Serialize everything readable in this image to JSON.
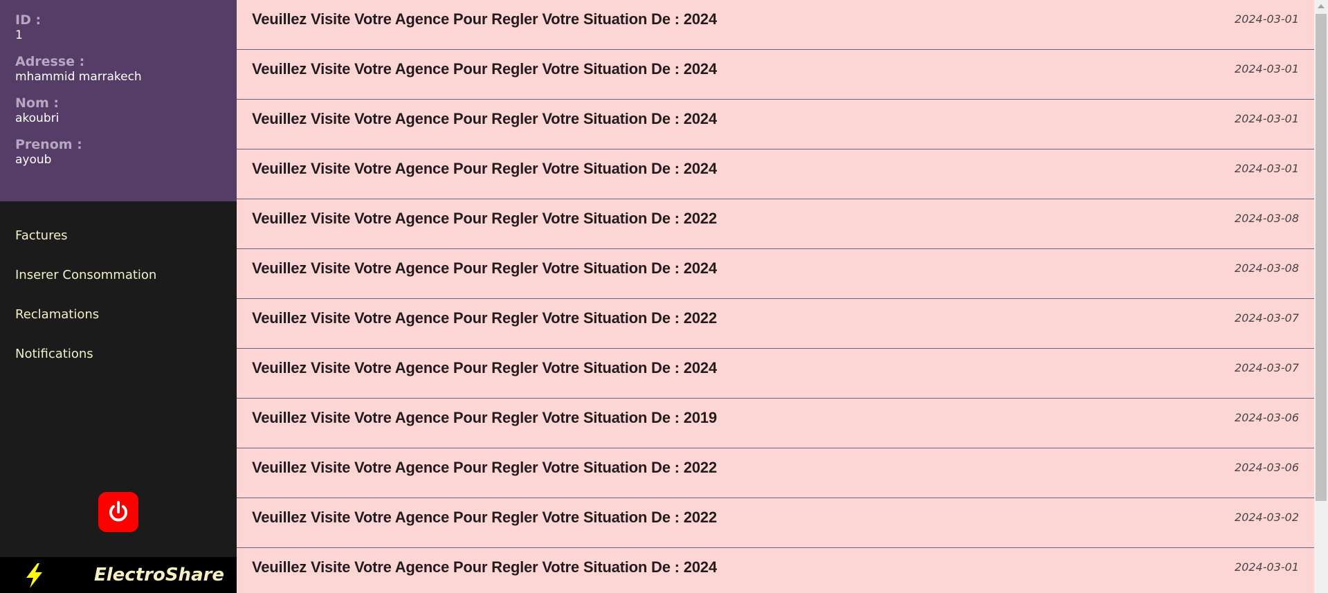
{
  "profile": {
    "id_label": "ID :",
    "id_value": "1",
    "address_label": "Adresse :",
    "address_value": "mhammid marrakech",
    "nom_label": "Nom :",
    "nom_value": "akoubri",
    "prenom_label": "Prenom :",
    "prenom_value": "ayoub"
  },
  "nav": {
    "items": [
      {
        "label": "Factures"
      },
      {
        "label": "Inserer Consommation"
      },
      {
        "label": "Reclamations"
      },
      {
        "label": "Notifications"
      }
    ]
  },
  "footer": {
    "power_icon": "power-icon",
    "brand_icon": "lightning-bolt-icon",
    "brand_name": "ElectroShare"
  },
  "notifications": [
    {
      "message": "Veuillez Visite Votre Agence Pour Regler Votre Situation De : 2024",
      "date": "2024-03-01"
    },
    {
      "message": "Veuillez Visite Votre Agence Pour Regler Votre Situation De : 2024",
      "date": "2024-03-01"
    },
    {
      "message": "Veuillez Visite Votre Agence Pour Regler Votre Situation De : 2024",
      "date": "2024-03-01"
    },
    {
      "message": "Veuillez Visite Votre Agence Pour Regler Votre Situation De : 2024",
      "date": "2024-03-01"
    },
    {
      "message": "Veuillez Visite Votre Agence Pour Regler Votre Situation De : 2022",
      "date": "2024-03-08"
    },
    {
      "message": "Veuillez Visite Votre Agence Pour Regler Votre Situation De : 2024",
      "date": "2024-03-08"
    },
    {
      "message": "Veuillez Visite Votre Agence Pour Regler Votre Situation De : 2022",
      "date": "2024-03-07"
    },
    {
      "message": "Veuillez Visite Votre Agence Pour Regler Votre Situation De : 2024",
      "date": "2024-03-07"
    },
    {
      "message": "Veuillez Visite Votre Agence Pour Regler Votre Situation De : 2019",
      "date": "2024-03-06"
    },
    {
      "message": "Veuillez Visite Votre Agence Pour Regler Votre Situation De : 2022",
      "date": "2024-03-06"
    },
    {
      "message": "Veuillez Visite Votre Agence Pour Regler Votre Situation De : 2022",
      "date": "2024-03-02"
    },
    {
      "message": "Veuillez Visite Votre Agence Pour Regler Votre Situation De : 2024",
      "date": "2024-03-01"
    }
  ],
  "colors": {
    "profile_bg": "#553d67",
    "sidebar_bg": "#1b1b1b",
    "row_bg": "#fcd5d5",
    "power_button": "#ff0000",
    "bolt": "#ffff00",
    "brand_text": "#f5f0c0"
  }
}
